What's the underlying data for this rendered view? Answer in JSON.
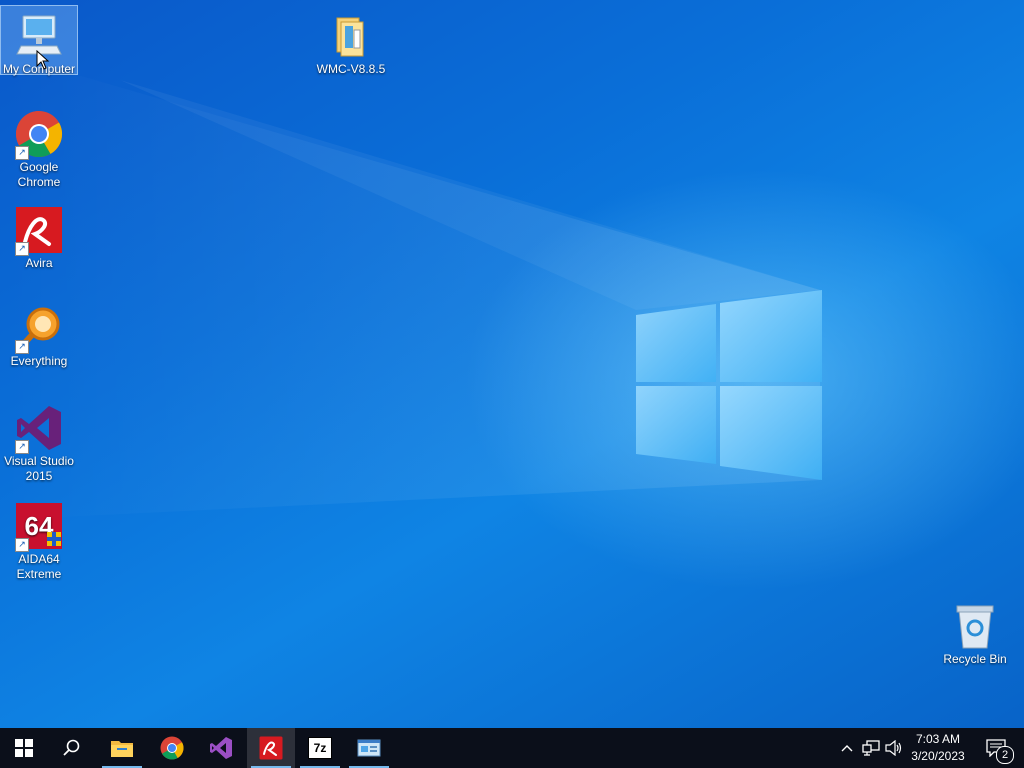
{
  "desktop": {
    "icons": [
      {
        "id": "my-computer",
        "label": "My Computer",
        "selected": true
      },
      {
        "id": "wmc",
        "label": "WMC-V8.8.5"
      },
      {
        "id": "chrome",
        "label": "Google Chrome"
      },
      {
        "id": "avira",
        "label": "Avira"
      },
      {
        "id": "everything",
        "label": "Everything"
      },
      {
        "id": "visual-studio",
        "label": "Visual Studio 2015"
      },
      {
        "id": "aida64",
        "label": "AIDA64 Extreme"
      },
      {
        "id": "recycle-bin",
        "label": "Recycle Bin"
      }
    ]
  },
  "taskbar": {
    "buttons": [
      {
        "id": "start",
        "icon": "windows-start-icon"
      },
      {
        "id": "search",
        "icon": "search-icon"
      },
      {
        "id": "file-explorer",
        "icon": "folder-icon"
      },
      {
        "id": "chrome",
        "icon": "chrome-icon"
      },
      {
        "id": "visual-studio",
        "icon": "visual-studio-icon"
      },
      {
        "id": "avira",
        "icon": "avira-icon"
      },
      {
        "id": "7zip",
        "icon": "7zip-icon",
        "text": "7z"
      },
      {
        "id": "system-app",
        "icon": "system-window-icon"
      }
    ],
    "tray": {
      "time": "7:03 AM",
      "date": "3/20/2023",
      "notification_count": "2"
    }
  },
  "colors": {
    "taskbar": "#0b0f1a",
    "accent": "#76b9ed",
    "desktop": "#0a6fd8"
  }
}
